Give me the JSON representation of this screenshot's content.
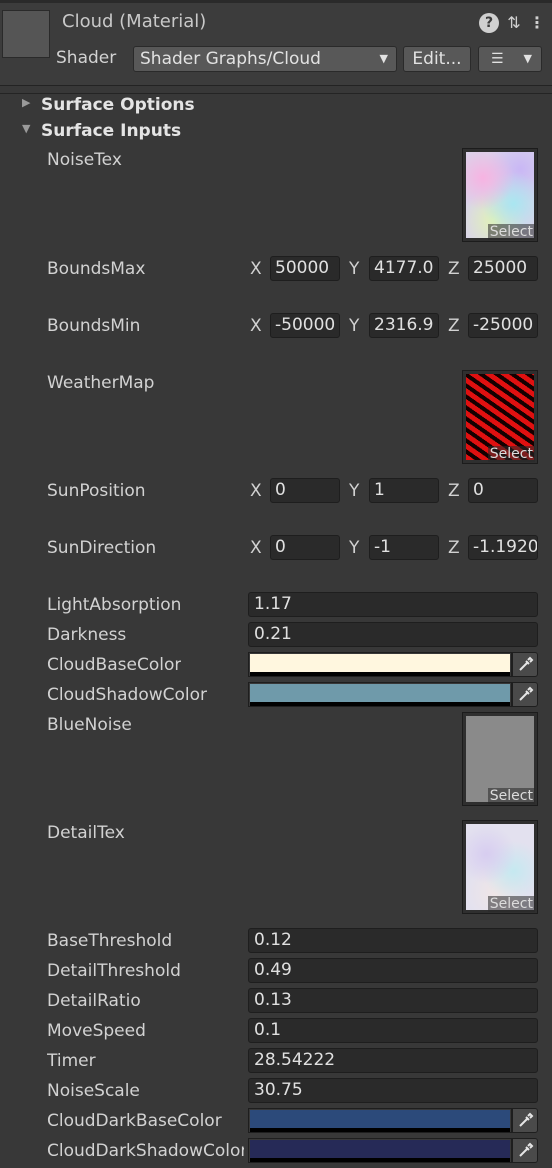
{
  "header": {
    "title": "Cloud (Material)",
    "help_icon": "?",
    "preset_icon": "⇅",
    "more_icon": "⋮",
    "shader_label": "Shader",
    "shader_value": "Shader Graphs/Cloud",
    "edit_label": "Edit...",
    "list_icon": "☰"
  },
  "sections": {
    "surface_options": "Surface Options",
    "surface_inputs": "Surface Inputs"
  },
  "properties": {
    "noise_tex": {
      "label": "NoiseTex",
      "select": "Select"
    },
    "bounds_max": {
      "label": "BoundsMax",
      "x": "50000",
      "y": "4177.0",
      "z": "25000"
    },
    "bounds_min": {
      "label": "BoundsMin",
      "x": "-50000",
      "y": "2316.9",
      "z": "-25000"
    },
    "weather_map": {
      "label": "WeatherMap",
      "select": "Select"
    },
    "sun_position": {
      "label": "SunPosition",
      "x": "0",
      "y": "1",
      "z": "0"
    },
    "sun_direction": {
      "label": "SunDirection",
      "x": "0",
      "y": "-1",
      "z": "-1.1920"
    },
    "light_absorption": {
      "label": "LightAbsorption",
      "value": "1.17"
    },
    "darkness": {
      "label": "Darkness",
      "value": "0.21"
    },
    "cloud_base_color": {
      "label": "CloudBaseColor",
      "color": "#fff7df"
    },
    "cloud_shadow_color": {
      "label": "CloudShadowColor",
      "color": "#6f9aaa"
    },
    "blue_noise": {
      "label": "BlueNoise",
      "select": "Select"
    },
    "detail_tex": {
      "label": "DetailTex",
      "select": "Select"
    },
    "base_threshold": {
      "label": "BaseThreshold",
      "value": "0.12"
    },
    "detail_threshold": {
      "label": "DetailThreshold",
      "value": "0.49"
    },
    "detail_ratio": {
      "label": "DetailRatio",
      "value": "0.13"
    },
    "move_speed": {
      "label": "MoveSpeed",
      "value": "0.1"
    },
    "timer": {
      "label": "Timer",
      "value": "28.54222"
    },
    "noise_scale": {
      "label": "NoiseScale",
      "value": "30.75"
    },
    "cloud_dark_base_color": {
      "label": "CloudDarkBaseColor",
      "color": "#2c4a7a"
    },
    "cloud_dark_shadow_color": {
      "label": "CloudDarkShadowColor",
      "color": "#262a57"
    }
  },
  "axis_labels": {
    "x": "X",
    "y": "Y",
    "z": "Z"
  },
  "icons": {
    "eyedropper": "eyedropper-icon",
    "foldout_collapsed": "▶",
    "foldout_expanded": "▼"
  }
}
